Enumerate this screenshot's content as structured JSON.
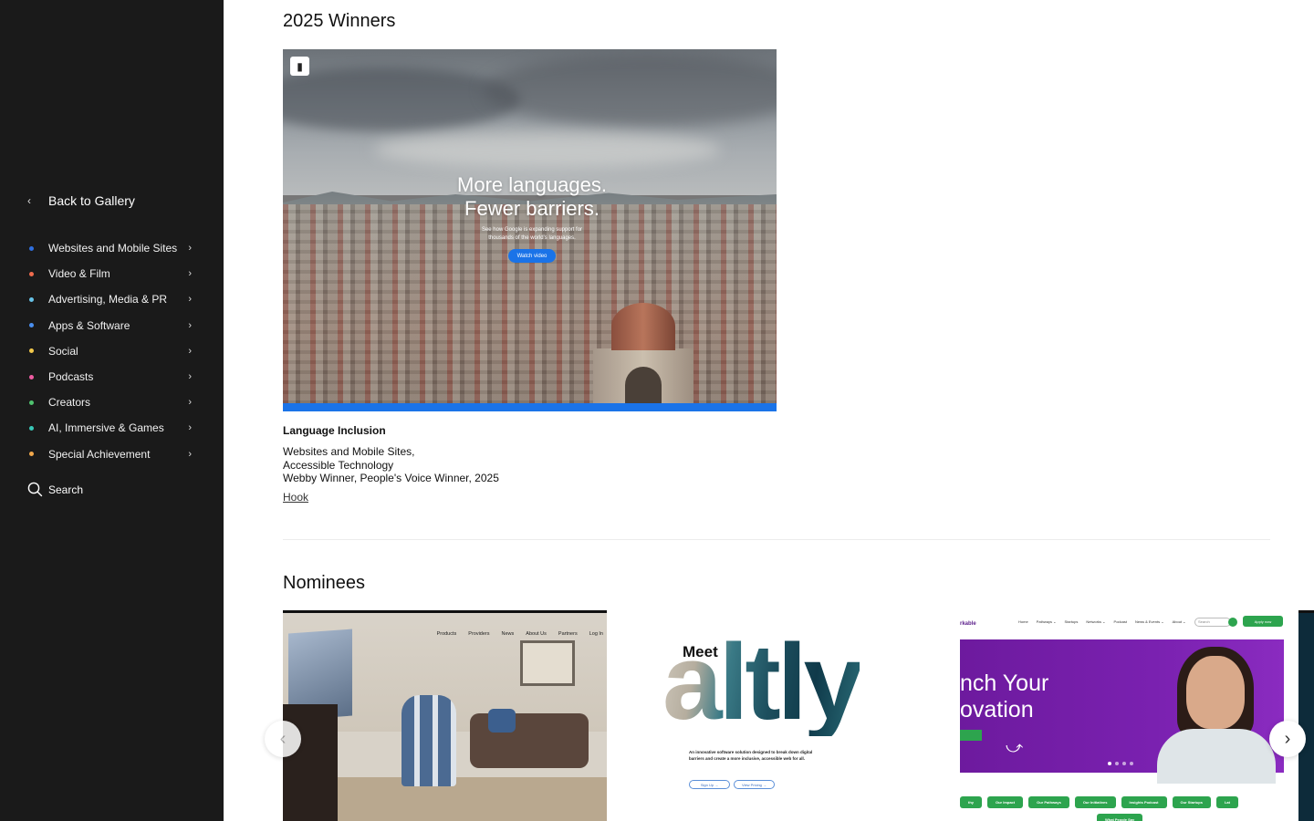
{
  "sidebar": {
    "back_label": "Back to Gallery",
    "categories": [
      {
        "label": "Websites and Mobile Sites",
        "color": "#2f6fe0"
      },
      {
        "label": "Video & Film",
        "color": "#f06b4d"
      },
      {
        "label": "Advertising, Media & PR",
        "color": "#67c3e8"
      },
      {
        "label": "Apps & Software",
        "color": "#4a8ff0"
      },
      {
        "label": "Social",
        "color": "#f2c84b"
      },
      {
        "label": "Podcasts",
        "color": "#ef5ca2"
      },
      {
        "label": "Creators",
        "color": "#4fc36f"
      },
      {
        "label": "AI, Immersive & Games",
        "color": "#39c8b8"
      },
      {
        "label": "Special Achievement",
        "color": "#f2a84b"
      }
    ],
    "search_label": "Search"
  },
  "winners": {
    "heading": "2025 Winners",
    "hero": {
      "headline_line1": "More languages.",
      "headline_line2": "Fewer barriers.",
      "sub_line1": "See how Google is expanding support for",
      "sub_line2": "thousands of the world’s languages.",
      "cta": "Watch video"
    },
    "entry": {
      "title": "Language Inclusion",
      "category_line1": "Websites and Mobile Sites,",
      "category_line2": "Accessible Technology",
      "award_line": "Webby Winner, People's Voice Winner, 2025",
      "agency": "Hook"
    }
  },
  "nominees": {
    "heading": "Nominees",
    "card1": {
      "nav": [
        "Products",
        "Providers",
        "News",
        "About Us",
        "Partners",
        "Log In"
      ]
    },
    "card2": {
      "meet": "Meet",
      "word": "altly",
      "body": "An innovative software solution designed to break down digital barriers and create a more inclusive, accessible web for all.",
      "btn1": "Sign Up →",
      "btn2": "View Pricing →"
    },
    "card3": {
      "logo": "rkable",
      "nav": [
        "Home",
        "Pathways ⌄",
        "Startups",
        "Networks ⌄",
        "Podcast",
        "News & Events ⌄",
        "About ⌄"
      ],
      "search_placeholder": "Search",
      "apply": "Apply now",
      "headline_line1": "nch Your",
      "headline_line2": "ovation",
      "pills": [
        "thy",
        "Our Impact",
        "Our Pathways",
        "Our Initiatives",
        "Insights Podcast",
        "Our Startups",
        "Lat",
        "What People Say"
      ]
    }
  }
}
